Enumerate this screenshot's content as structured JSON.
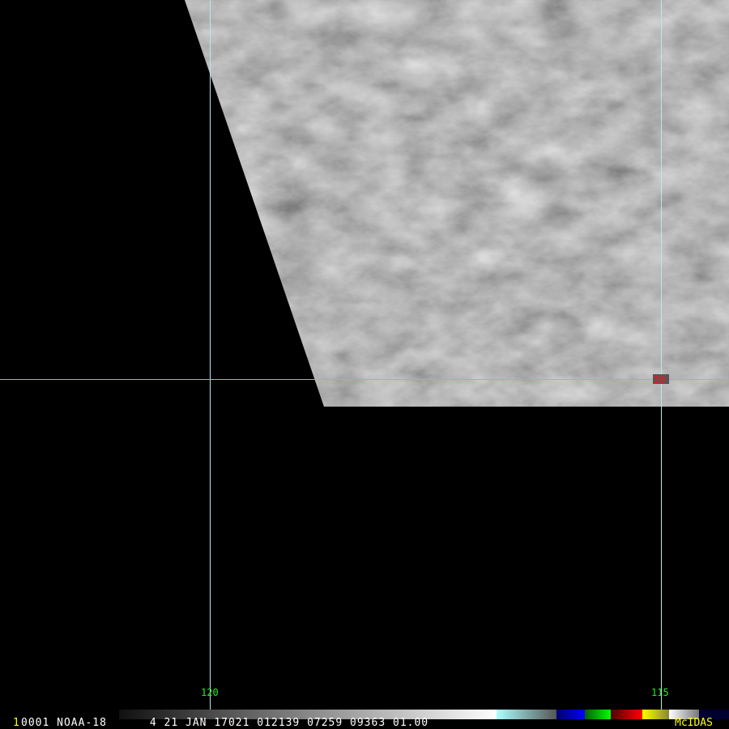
{
  "footer": {
    "frame_number": "1",
    "info": "0001 NOAA-18      4 21 JAN 17021 012139 07259 09363 01.00",
    "brand": "McIDAS"
  },
  "grid": {
    "longitude_labels": [
      "120",
      "115"
    ],
    "marker_label": "20"
  },
  "colors": {
    "grid_line": "#33dde6",
    "grid_label": "#22ee22",
    "marker": "#ff1111",
    "brand": "#ffff00"
  }
}
